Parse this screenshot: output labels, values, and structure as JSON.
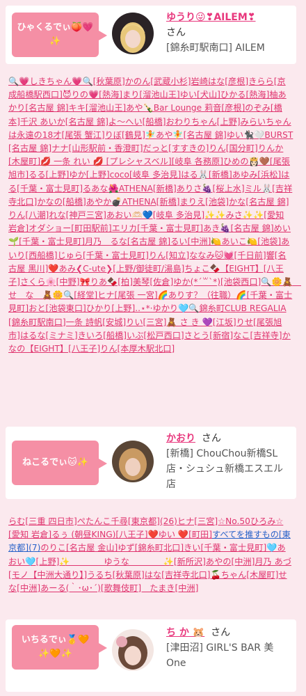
{
  "entries": [
    {
      "bubble": "ひゃくるでぃ🍑💗✨",
      "name": "ゆうり😜❣AILEM❣",
      "honorific": "さん",
      "shop": "[錦糸町駅南口] AILEM"
    },
    {
      "bubble": "ねこるでぃ🐱✨",
      "name": "かおり",
      "honorific": "さん",
      "shop": "[新橋] ChouChou新橋SL店・シュシュ新橋エスエル店"
    },
    {
      "bubble": "いちるでぃ🥇🧡✨🧡✨",
      "name": "ち か 🐹",
      "honorific": "さん",
      "shop": "[津田沼] GIRL'S BAR 美One"
    }
  ],
  "list1": "🔍💗しきちゃん💗🔍[秋葉原]かのん[武蔵小杉]岩崎はな[彦根]きらら[京成船橋駅西口]😈りの💗[熱海]まり[溜池山王]ゆい[犬山]ひかる[熱海]柚あかり[名古屋 錦]キキ[溜池山王]あや🍾Bar Lounge 莉音[彦根]のぞみ[橋本]千沢 あいか[名古屋 錦]よ～へい[船橋]おわりちゃん[上野]みらいちゃんは永遠の18才[尾張 蟹江]りぼ[鶴見]🧚あや🧚[名古屋 錦]ゆい🐈‍⬛🤍BURST[名古屋 錦]ナナ[山形駅前・香澄町]だっと[すすきの]りん[国分町]りんか[木屋町]💋 一条 れい 💋 [プレシャスベル][岐阜 各務原]ひめの👸🏻🤎[尾張旭市]るる[上野]ゆか[上野]coco[岐阜 多治見]はる🐰[新橋]あゆみ[浜松]はる[千葉・富士見町]るあな🌺ATHENA[新橋]ありさ🍇[桜上水]ミル🐰[吉祥寺北口]かなの[船橋]あやか💣ATHENA[新橋]まりえ[池袋]かな[名古屋 錦]りん[八潮]れな[神戸三宮]あおい🫶🏻💙[岐阜 多治見]✨✨みさ✨✨[愛知 岩倉]オダショー[町田駅前]エリカ[千葉・富士見町]あき🍇[名古屋 錦]めい🌱[千葉・富士見町]月乃　るな[名古屋 錦]るい[中洲]🍋あいこ🍋[池袋]あいり[西船橋]じゅら[千葉・富士見町]りん[知立]ななみ🐱💓[千日前]響[名古屋 黒川]❤️あみ❮C-ute❯[上野/御徒町/湯島]ちょこ🍫【EIGHT】[八王子]さくら🌸[中野]🎀りあ🍫[柏]美琴[佐倉]ゆか(*´꒳`*)[池袋西口]🔍🌼🧸　せ　な　🧸🌼🔍[経堂]ヒナ[尾張 一宮]🌈ありす？（往職）🌈[千葉・富士見町]おと[池袋東口]ひかり[上野]..⋆*·ゆかり🩵🔍錦糸町CLUB REGALIA[錦糸町駅南口]一条 詩帆[安城]りい[三宮]🧸 さ き 💜[江坂]りせ[尾張旭市]はるな[ミナミ]きいろ[船橋]いぶ[松戸西口]さとう[新宿]なこ[吉祥寺]かなの【EIGHT】[八王子]りん[本厚木駅北口]",
  "list2_a": "らむ[三重 四日市]ぺたんこ千尋[東京都](26)ヒナ[三宮]☆No.50ひろみ☆[愛知 岩倉]るぅ (朝昼KING)[八王子]❤️ゆい ❤️[町田]",
  "list2_blue": "すべてを推すもの[東京都](7)",
  "list2_b": "のりこ[名古屋 金山]ゆず[錦糸町北口]きい[千葉・富士見町]🩵あおい🩵[上野]✨　　　　ゆうな　　　　✨[新所沢]あやの[中洲]月乃 あづ[モノ【中洲大通り】]うるち[秋葉原]はな[吉祥寺北口]🍒ちゃん[木屋町]せな[中洲]あーる(｀･ω･´)[歌舞伎町]　たまき[中洲]"
}
